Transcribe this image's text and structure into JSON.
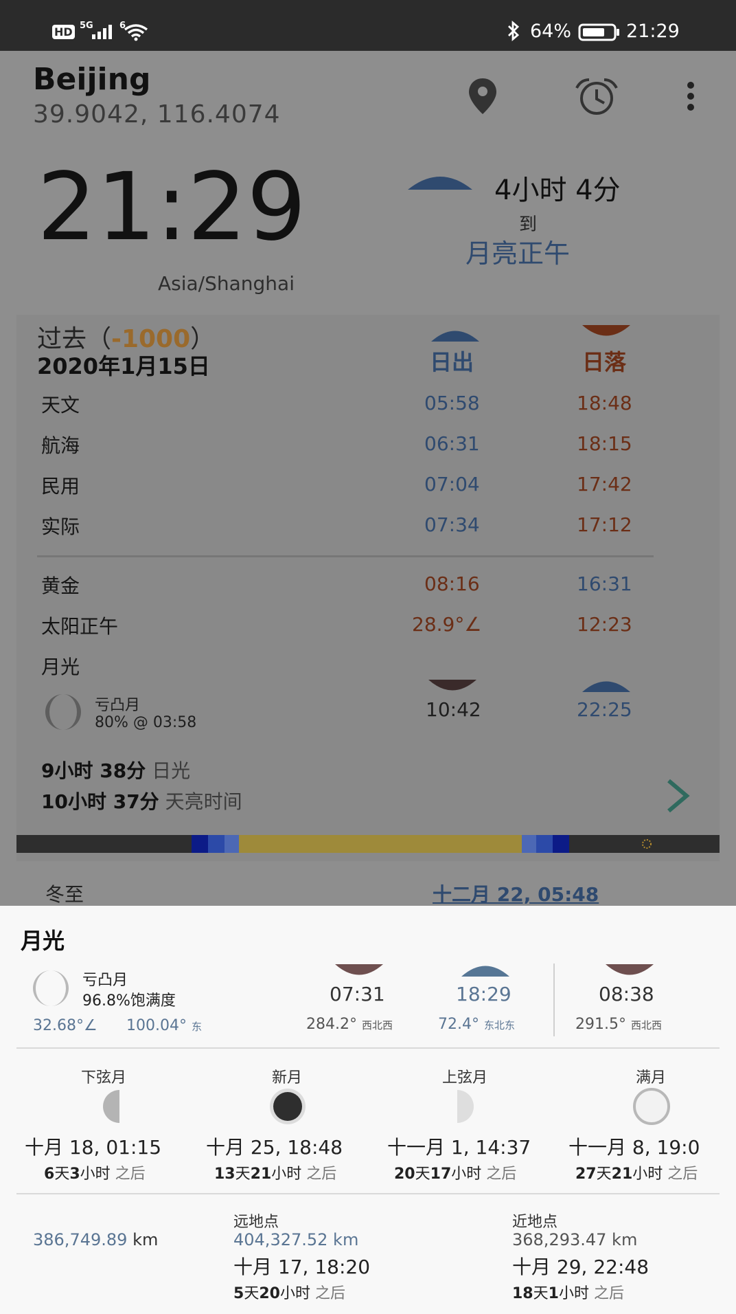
{
  "status_bar": {
    "hd": "HD",
    "signal": "5G",
    "wifi_badge": "6",
    "battery": "64%",
    "time": "21:29"
  },
  "header": {
    "city": "Beijing",
    "coords": "39.9042, 116.4074"
  },
  "clock": {
    "time": "21:29",
    "timezone": "Asia/Shanghai"
  },
  "countdown": {
    "duration": "4小时 4分",
    "to": "到",
    "event": "月亮正午"
  },
  "date_card": {
    "past_prefix": "过去（",
    "past_value": "-1000",
    "past_suffix": "）",
    "date": "2020年1月15日",
    "col_rise": "日出",
    "col_set": "日落",
    "rows": [
      {
        "label": "天文",
        "rise": "05:58",
        "set": "18:48"
      },
      {
        "label": "航海",
        "rise": "06:31",
        "set": "18:15"
      },
      {
        "label": "民用",
        "rise": "07:04",
        "set": "17:42"
      },
      {
        "label": "实际",
        "rise": "07:34",
        "set": "17:12"
      }
    ],
    "golden": {
      "label": "黄金",
      "rise": "08:16",
      "set": "16:31"
    },
    "solar_noon": {
      "label": "太阳正午",
      "angle": "28.9°∠",
      "time": "12:23"
    },
    "moonlight": {
      "label": "月光",
      "phase": "亏凸月",
      "illum": "80% @ 03:58",
      "rise": "10:42",
      "set": "22:25"
    },
    "daylight_value": "9小时 38分",
    "daylight_label": "日光",
    "dawn_value": "10小时 37分",
    "dawn_label": "天亮时间"
  },
  "solstice": {
    "label": "冬至",
    "date": "十二月 22, 05:48"
  },
  "sheet": {
    "title": "月光",
    "phase": "亏凸月",
    "fullness": "96.8%饱满度",
    "altitude": "32.68°∠",
    "azimuth": "100.04°",
    "azimuth_dir": "东",
    "rise1": {
      "time": "07:31",
      "deg": "284.2°",
      "dir": "西北西"
    },
    "rise2": {
      "time": "18:29",
      "deg": "72.4°",
      "dir": "东北东"
    },
    "set": {
      "time": "08:38",
      "deg": "291.5°",
      "dir": "西北西"
    },
    "phases": [
      {
        "name": "下弦月",
        "date": "十月 18, 01:15",
        "d": "6",
        "h": "3",
        "unit_d": "天",
        "unit_h": "小时",
        "after": "之后"
      },
      {
        "name": "新月",
        "date": "十月 25, 18:48",
        "d": "13",
        "h": "21",
        "unit_d": "天",
        "unit_h": "小时",
        "after": "之后"
      },
      {
        "name": "上弦月",
        "date": "十一月 1, 14:37",
        "d": "20",
        "h": "17",
        "unit_d": "天",
        "unit_h": "小时",
        "after": "之后"
      },
      {
        "name": "满月",
        "date": "十一月 8, 19:0",
        "d": "27",
        "h": "21",
        "unit_d": "天",
        "unit_h": "小时",
        "after": "之后"
      }
    ],
    "distance": "386,749.89",
    "distance_unit": "km",
    "apogee": {
      "label": "远地点",
      "dist": "404,327.52 km",
      "date": "十月 17, 18:20",
      "d": "5",
      "h": "20",
      "unit_d": "天",
      "unit_h": "小时",
      "after": "之后"
    },
    "perigee": {
      "label": "近地点",
      "dist": "368,293.47 km",
      "date": "十月 29, 22:48",
      "d": "18",
      "h": "1",
      "unit_d": "天",
      "unit_h": "小时",
      "after": "之后"
    }
  }
}
